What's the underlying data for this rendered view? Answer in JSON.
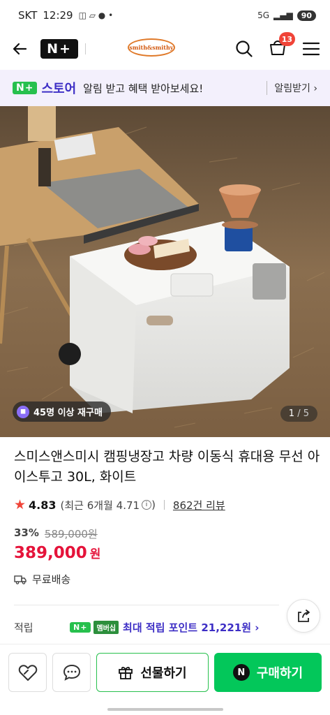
{
  "status_bar": {
    "carrier": "SKT",
    "time": "12:29",
    "network": "5G",
    "battery": "90"
  },
  "header": {
    "store_badge": "N+",
    "brand_logo": "smith&smithy",
    "cart_count": "13"
  },
  "promo": {
    "badge": "N+",
    "store": "스토어",
    "text": "알림 받고 혜택 받아보세요!",
    "link": "알림받기 ›"
  },
  "hero": {
    "rebuy_text": "45명 이상 재구매",
    "page_current": "1",
    "page_total": "/ 5"
  },
  "product": {
    "title": "스미스앤스미시 캠핑냉장고 차량 이동식 휴대용 무선 아이스투고 30L, 화이트",
    "rating": "4.83",
    "recent_rating": "(최근 6개월 4.71",
    "recent_rating_close": ")",
    "reviews": "862건 리뷰",
    "discount": "33%",
    "original_price": "589,000원",
    "price": "389,000",
    "currency": "원",
    "shipping": "무료배송"
  },
  "points": {
    "label": "적립",
    "badge": "N+",
    "member": "멤버십",
    "max_points": "최대 적립 포인트 21,221원 ›"
  },
  "bottom": {
    "gift": "선물하기",
    "buy": "구매하기",
    "buy_icon": "N"
  },
  "colors": {
    "accent_green": "#03c75a",
    "price_red": "#e5133a",
    "store_purple": "#3d2ec5"
  }
}
